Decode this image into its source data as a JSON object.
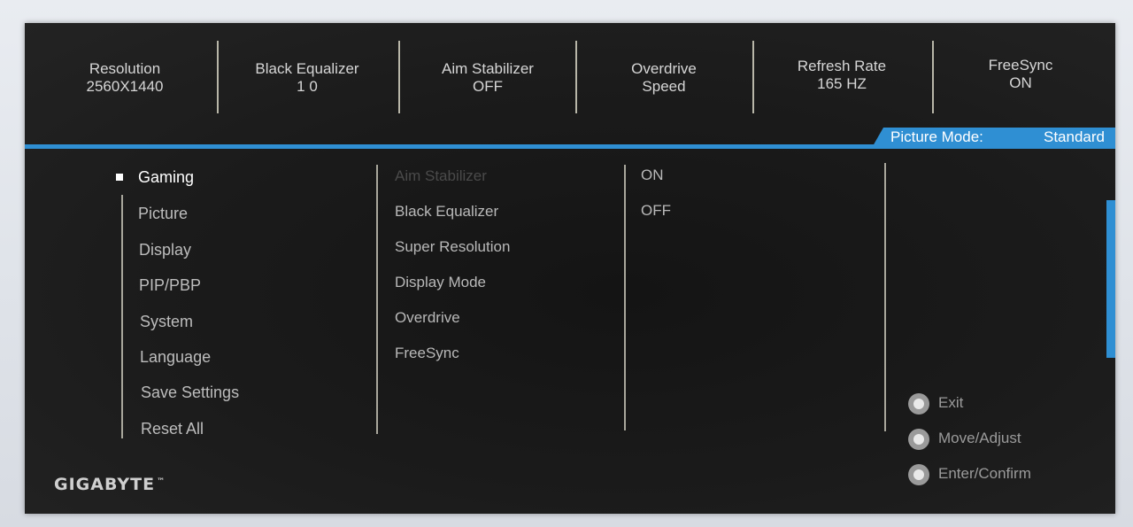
{
  "status": [
    {
      "label": "Resolution",
      "value": "2560X1440"
    },
    {
      "label": "Black Equalizer",
      "value": "1 0"
    },
    {
      "label": "Aim Stabilizer",
      "value": "OFF"
    },
    {
      "label": "Overdrive",
      "value": "Speed"
    },
    {
      "label": "Refresh Rate",
      "value": "165 HZ"
    },
    {
      "label": "FreeSync",
      "value": "ON"
    }
  ],
  "picture_mode": {
    "label": "Picture Mode:",
    "value": "Standard"
  },
  "main_menu": [
    {
      "label": "Gaming",
      "selected": true
    },
    {
      "label": "Picture"
    },
    {
      "label": "Display"
    },
    {
      "label": "PIP/PBP"
    },
    {
      "label": "System"
    },
    {
      "label": "Language"
    },
    {
      "label": "Save Settings"
    },
    {
      "label": "Reset All"
    }
  ],
  "sub_menu": [
    {
      "label": "Aim Stabilizer",
      "dimmed": true
    },
    {
      "label": "Black Equalizer"
    },
    {
      "label": "Super Resolution"
    },
    {
      "label": "Display Mode"
    },
    {
      "label": "Overdrive"
    },
    {
      "label": "FreeSync"
    }
  ],
  "options": [
    "ON",
    "OFF"
  ],
  "key_guide": [
    "Exit",
    "Move/Adjust",
    "Enter/Confirm"
  ],
  "brand": "GIGABYTE",
  "brand_tm": "™",
  "colors": {
    "accent": "#2f8fd3",
    "panel_bg": "#1b1b1b",
    "divider": "#a9a79c",
    "text_active": "#ffffff",
    "text_normal": "#bdbdbd",
    "text_disabled": "#4a4a4a"
  }
}
